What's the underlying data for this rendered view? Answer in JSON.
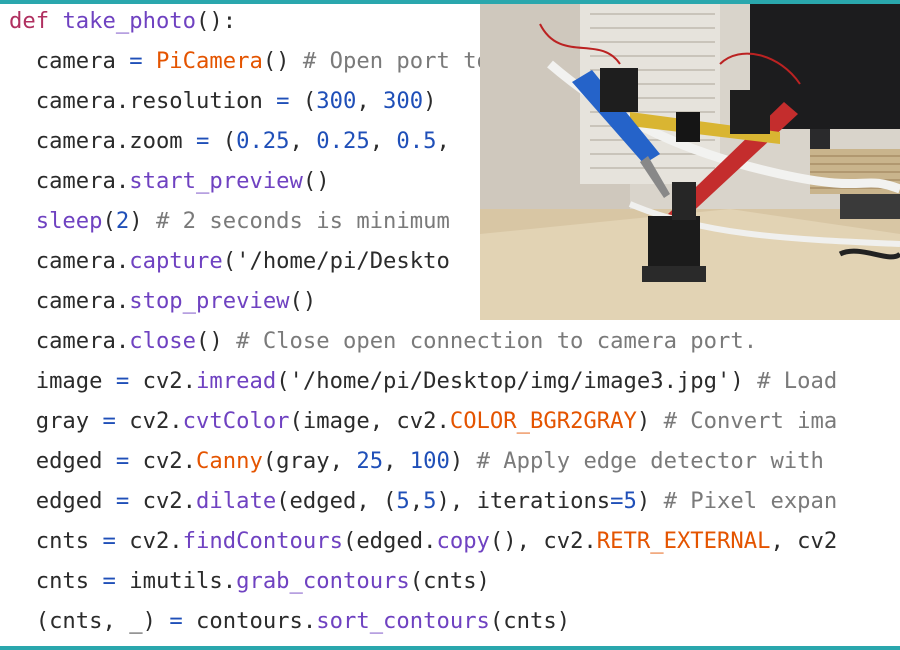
{
  "code": {
    "lines": [
      {
        "indent": "",
        "tokens": [
          {
            "t": "def",
            "c": "kw"
          },
          {
            "t": " "
          },
          {
            "t": "take_photo",
            "c": "fn"
          },
          {
            "t": "():"
          }
        ]
      },
      {
        "indent": "  ",
        "tokens": [
          {
            "t": "camera "
          },
          {
            "t": "=",
            "c": "op"
          },
          {
            "t": " "
          },
          {
            "t": "PiCamera",
            "c": "cls"
          },
          {
            "t": "() "
          },
          {
            "t": "# Open port to camera.",
            "c": "cm"
          }
        ]
      },
      {
        "indent": "  ",
        "tokens": [
          {
            "t": "camera.resolution "
          },
          {
            "t": "=",
            "c": "op"
          },
          {
            "t": " ("
          },
          {
            "t": "300",
            "c": "num"
          },
          {
            "t": ", "
          },
          {
            "t": "300",
            "c": "num"
          },
          {
            "t": ")"
          }
        ]
      },
      {
        "indent": "  ",
        "tokens": [
          {
            "t": "camera.zoom "
          },
          {
            "t": "=",
            "c": "op"
          },
          {
            "t": " ("
          },
          {
            "t": "0.25",
            "c": "num"
          },
          {
            "t": ", "
          },
          {
            "t": "0.25",
            "c": "num"
          },
          {
            "t": ", "
          },
          {
            "t": "0.5",
            "c": "num"
          },
          {
            "t": ","
          }
        ]
      },
      {
        "indent": "  ",
        "tokens": [
          {
            "t": "camera."
          },
          {
            "t": "start_preview",
            "c": "fn"
          },
          {
            "t": "()"
          }
        ]
      },
      {
        "indent": "  ",
        "tokens": [
          {
            "t": "sleep",
            "c": "fn"
          },
          {
            "t": "("
          },
          {
            "t": "2",
            "c": "num"
          },
          {
            "t": ") "
          },
          {
            "t": "# 2 seconds is minimum",
            "c": "cm"
          }
        ]
      },
      {
        "indent": "  ",
        "tokens": [
          {
            "t": "camera."
          },
          {
            "t": "capture",
            "c": "fn"
          },
          {
            "t": "('/home/pi/Deskto",
            "c": "str"
          }
        ]
      },
      {
        "indent": "  ",
        "tokens": [
          {
            "t": "camera."
          },
          {
            "t": "stop_preview",
            "c": "fn"
          },
          {
            "t": "()"
          }
        ]
      },
      {
        "indent": "  ",
        "tokens": [
          {
            "t": "camera."
          },
          {
            "t": "close",
            "c": "fn"
          },
          {
            "t": "() "
          },
          {
            "t": "# Close open connection to camera port.",
            "c": "cm"
          }
        ]
      },
      {
        "indent": "  ",
        "tokens": [
          {
            "t": "image "
          },
          {
            "t": "=",
            "c": "op"
          },
          {
            "t": " cv2."
          },
          {
            "t": "imread",
            "c": "fn"
          },
          {
            "t": "('/home/pi/Desktop/img/image3.jpg') "
          },
          {
            "t": "# Load",
            "c": "cm"
          }
        ]
      },
      {
        "indent": "  ",
        "tokens": [
          {
            "t": "gray "
          },
          {
            "t": "=",
            "c": "op"
          },
          {
            "t": " cv2."
          },
          {
            "t": "cvtColor",
            "c": "fn"
          },
          {
            "t": "(image, cv2."
          },
          {
            "t": "COLOR_BGR2GRAY",
            "c": "cls"
          },
          {
            "t": ") "
          },
          {
            "t": "# Convert ima",
            "c": "cm"
          }
        ]
      },
      {
        "indent": "  ",
        "tokens": [
          {
            "t": "edged "
          },
          {
            "t": "=",
            "c": "op"
          },
          {
            "t": " cv2."
          },
          {
            "t": "Canny",
            "c": "cls"
          },
          {
            "t": "(gray, "
          },
          {
            "t": "25",
            "c": "num"
          },
          {
            "t": ", "
          },
          {
            "t": "100",
            "c": "num"
          },
          {
            "t": ") "
          },
          {
            "t": "# Apply edge detector with",
            "c": "cm"
          }
        ]
      },
      {
        "indent": "  ",
        "tokens": [
          {
            "t": "edged "
          },
          {
            "t": "=",
            "c": "op"
          },
          {
            "t": " cv2."
          },
          {
            "t": "dilate",
            "c": "fn"
          },
          {
            "t": "(edged, ("
          },
          {
            "t": "5",
            "c": "num"
          },
          {
            "t": ","
          },
          {
            "t": "5",
            "c": "num"
          },
          {
            "t": "), iterations"
          },
          {
            "t": "=",
            "c": "op"
          },
          {
            "t": "5",
            "c": "num"
          },
          {
            "t": ") "
          },
          {
            "t": "# Pixel expan",
            "c": "cm"
          }
        ]
      },
      {
        "indent": "  ",
        "tokens": [
          {
            "t": "cnts "
          },
          {
            "t": "=",
            "c": "op"
          },
          {
            "t": " cv2."
          },
          {
            "t": "findContours",
            "c": "fn"
          },
          {
            "t": "(edged."
          },
          {
            "t": "copy",
            "c": "fn"
          },
          {
            "t": "(), cv2."
          },
          {
            "t": "RETR_EXTERNAL",
            "c": "cls"
          },
          {
            "t": ", cv2"
          }
        ]
      },
      {
        "indent": "  ",
        "tokens": [
          {
            "t": "cnts "
          },
          {
            "t": "=",
            "c": "op"
          },
          {
            "t": " imutils."
          },
          {
            "t": "grab_contours",
            "c": "fn"
          },
          {
            "t": "(cnts)"
          }
        ]
      },
      {
        "indent": "  ",
        "tokens": [
          {
            "t": "(cnts, _) "
          },
          {
            "t": "=",
            "c": "op"
          },
          {
            "t": " contours."
          },
          {
            "t": "sort_contours",
            "c": "fn"
          },
          {
            "t": "(cnts)"
          }
        ]
      }
    ]
  },
  "colors": {
    "keyword": "#b03060",
    "function": "#6f42c1",
    "constant": "#e45400",
    "number": "#1f4fb8",
    "comment": "#7a7a7a",
    "frame": "#2aa7ad"
  }
}
